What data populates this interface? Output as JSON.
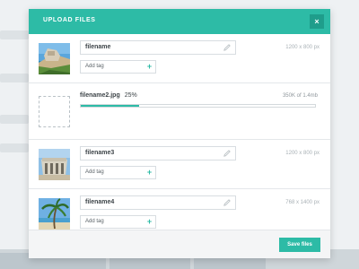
{
  "modal": {
    "title": "UPLOAD FILES",
    "close_label": "×",
    "accent_color": "#2dbba6"
  },
  "files": [
    {
      "name": "filename",
      "tag_placeholder": "Add tag",
      "add_label": "+",
      "dimensions": "1200 x 800 px",
      "thumb": "beach-ruins"
    },
    {
      "name": "filename2.jpg",
      "progress_label": "25%",
      "progress": 0.25,
      "size_label": "350K of 1.4mb",
      "uploading": true
    },
    {
      "name": "filename3",
      "tag_placeholder": "Add tag",
      "add_label": "+",
      "dimensions": "1200 x 800 px",
      "thumb": "temple"
    },
    {
      "name": "filename4",
      "tag_placeholder": "Add tag",
      "add_label": "+",
      "dimensions": "768 x 1400 px",
      "thumb": "palm-tree"
    }
  ],
  "footer": {
    "save_label": "Save files"
  }
}
